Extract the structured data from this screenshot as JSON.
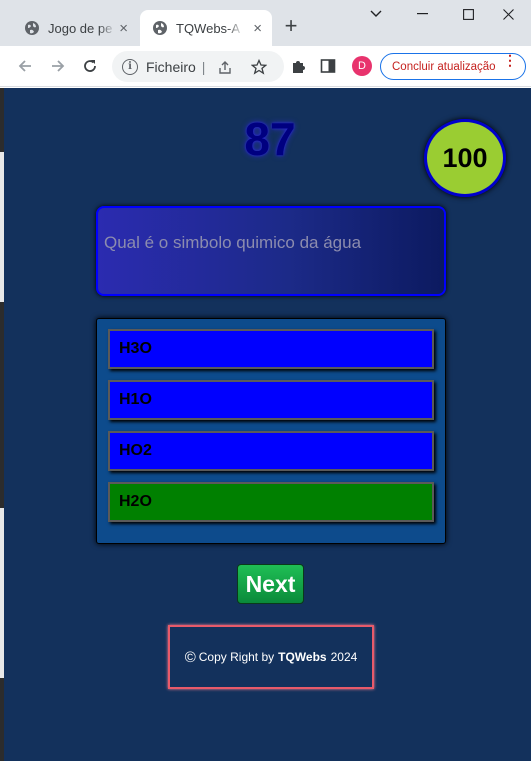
{
  "browser": {
    "tabs": [
      {
        "title": "Jogo de pe",
        "close": "×"
      },
      {
        "title": "TQWebs-A",
        "close": "×"
      }
    ],
    "new_tab": "+",
    "window_controls": {
      "minimize": "⌄",
      "maximize": "□",
      "close": "✕",
      "more": "—"
    },
    "address_bar": {
      "label": "Ficheiro",
      "separator": "|"
    },
    "profile_initial": "D",
    "update_button": "Concluir atualização",
    "menu_dots": "⋮"
  },
  "game": {
    "timer": "87",
    "score": "100",
    "question": "Qual é o simbolo quimico da água",
    "answers": [
      {
        "label": "H3O",
        "state": "default"
      },
      {
        "label": "H1O",
        "state": "default"
      },
      {
        "label": "HO2",
        "state": "default"
      },
      {
        "label": "H2O",
        "state": "correct"
      }
    ],
    "next_button": "Next"
  },
  "footer": {
    "symbol": "©",
    "text": "Copy Right by",
    "brand": "TQWebs",
    "year": "2024"
  },
  "colors": {
    "page_background": "#13315c",
    "answer_default": "#0000ff",
    "answer_correct": "#008000",
    "score_circle": "#9acd32",
    "next_button": "#14a84a"
  },
  "icons": [
    "globe-icon",
    "back-arrow-icon",
    "forward-arrow-icon",
    "reload-icon",
    "info-icon",
    "share-icon",
    "star-icon",
    "puzzle-icon",
    "sidebar-icon"
  ]
}
